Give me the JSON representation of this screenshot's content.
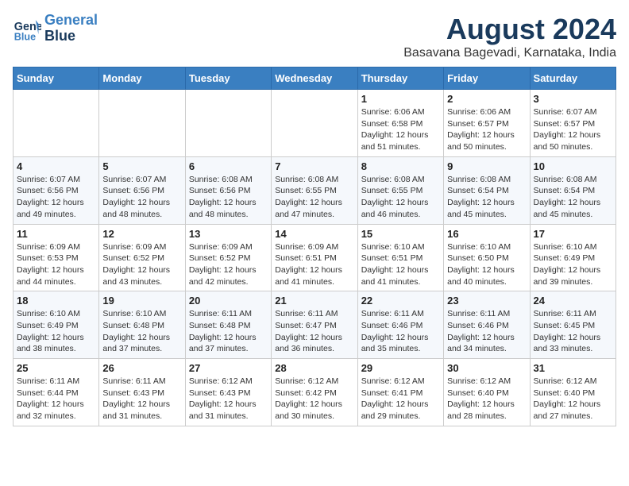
{
  "logo": {
    "line1": "General",
    "line2": "Blue"
  },
  "title": "August 2024",
  "subtitle": "Basavana Bagevadi, Karnataka, India",
  "days_of_week": [
    "Sunday",
    "Monday",
    "Tuesday",
    "Wednesday",
    "Thursday",
    "Friday",
    "Saturday"
  ],
  "weeks": [
    [
      {
        "day": "",
        "info": ""
      },
      {
        "day": "",
        "info": ""
      },
      {
        "day": "",
        "info": ""
      },
      {
        "day": "",
        "info": ""
      },
      {
        "day": "1",
        "info": "Sunrise: 6:06 AM\nSunset: 6:58 PM\nDaylight: 12 hours and 51 minutes."
      },
      {
        "day": "2",
        "info": "Sunrise: 6:06 AM\nSunset: 6:57 PM\nDaylight: 12 hours and 50 minutes."
      },
      {
        "day": "3",
        "info": "Sunrise: 6:07 AM\nSunset: 6:57 PM\nDaylight: 12 hours and 50 minutes."
      }
    ],
    [
      {
        "day": "4",
        "info": "Sunrise: 6:07 AM\nSunset: 6:56 PM\nDaylight: 12 hours and 49 minutes."
      },
      {
        "day": "5",
        "info": "Sunrise: 6:07 AM\nSunset: 6:56 PM\nDaylight: 12 hours and 48 minutes."
      },
      {
        "day": "6",
        "info": "Sunrise: 6:08 AM\nSunset: 6:56 PM\nDaylight: 12 hours and 48 minutes."
      },
      {
        "day": "7",
        "info": "Sunrise: 6:08 AM\nSunset: 6:55 PM\nDaylight: 12 hours and 47 minutes."
      },
      {
        "day": "8",
        "info": "Sunrise: 6:08 AM\nSunset: 6:55 PM\nDaylight: 12 hours and 46 minutes."
      },
      {
        "day": "9",
        "info": "Sunrise: 6:08 AM\nSunset: 6:54 PM\nDaylight: 12 hours and 45 minutes."
      },
      {
        "day": "10",
        "info": "Sunrise: 6:08 AM\nSunset: 6:54 PM\nDaylight: 12 hours and 45 minutes."
      }
    ],
    [
      {
        "day": "11",
        "info": "Sunrise: 6:09 AM\nSunset: 6:53 PM\nDaylight: 12 hours and 44 minutes."
      },
      {
        "day": "12",
        "info": "Sunrise: 6:09 AM\nSunset: 6:52 PM\nDaylight: 12 hours and 43 minutes."
      },
      {
        "day": "13",
        "info": "Sunrise: 6:09 AM\nSunset: 6:52 PM\nDaylight: 12 hours and 42 minutes."
      },
      {
        "day": "14",
        "info": "Sunrise: 6:09 AM\nSunset: 6:51 PM\nDaylight: 12 hours and 41 minutes."
      },
      {
        "day": "15",
        "info": "Sunrise: 6:10 AM\nSunset: 6:51 PM\nDaylight: 12 hours and 41 minutes."
      },
      {
        "day": "16",
        "info": "Sunrise: 6:10 AM\nSunset: 6:50 PM\nDaylight: 12 hours and 40 minutes."
      },
      {
        "day": "17",
        "info": "Sunrise: 6:10 AM\nSunset: 6:49 PM\nDaylight: 12 hours and 39 minutes."
      }
    ],
    [
      {
        "day": "18",
        "info": "Sunrise: 6:10 AM\nSunset: 6:49 PM\nDaylight: 12 hours and 38 minutes."
      },
      {
        "day": "19",
        "info": "Sunrise: 6:10 AM\nSunset: 6:48 PM\nDaylight: 12 hours and 37 minutes."
      },
      {
        "day": "20",
        "info": "Sunrise: 6:11 AM\nSunset: 6:48 PM\nDaylight: 12 hours and 37 minutes."
      },
      {
        "day": "21",
        "info": "Sunrise: 6:11 AM\nSunset: 6:47 PM\nDaylight: 12 hours and 36 minutes."
      },
      {
        "day": "22",
        "info": "Sunrise: 6:11 AM\nSunset: 6:46 PM\nDaylight: 12 hours and 35 minutes."
      },
      {
        "day": "23",
        "info": "Sunrise: 6:11 AM\nSunset: 6:46 PM\nDaylight: 12 hours and 34 minutes."
      },
      {
        "day": "24",
        "info": "Sunrise: 6:11 AM\nSunset: 6:45 PM\nDaylight: 12 hours and 33 minutes."
      }
    ],
    [
      {
        "day": "25",
        "info": "Sunrise: 6:11 AM\nSunset: 6:44 PM\nDaylight: 12 hours and 32 minutes."
      },
      {
        "day": "26",
        "info": "Sunrise: 6:11 AM\nSunset: 6:43 PM\nDaylight: 12 hours and 31 minutes."
      },
      {
        "day": "27",
        "info": "Sunrise: 6:12 AM\nSunset: 6:43 PM\nDaylight: 12 hours and 31 minutes."
      },
      {
        "day": "28",
        "info": "Sunrise: 6:12 AM\nSunset: 6:42 PM\nDaylight: 12 hours and 30 minutes."
      },
      {
        "day": "29",
        "info": "Sunrise: 6:12 AM\nSunset: 6:41 PM\nDaylight: 12 hours and 29 minutes."
      },
      {
        "day": "30",
        "info": "Sunrise: 6:12 AM\nSunset: 6:40 PM\nDaylight: 12 hours and 28 minutes."
      },
      {
        "day": "31",
        "info": "Sunrise: 6:12 AM\nSunset: 6:40 PM\nDaylight: 12 hours and 27 minutes."
      }
    ]
  ]
}
